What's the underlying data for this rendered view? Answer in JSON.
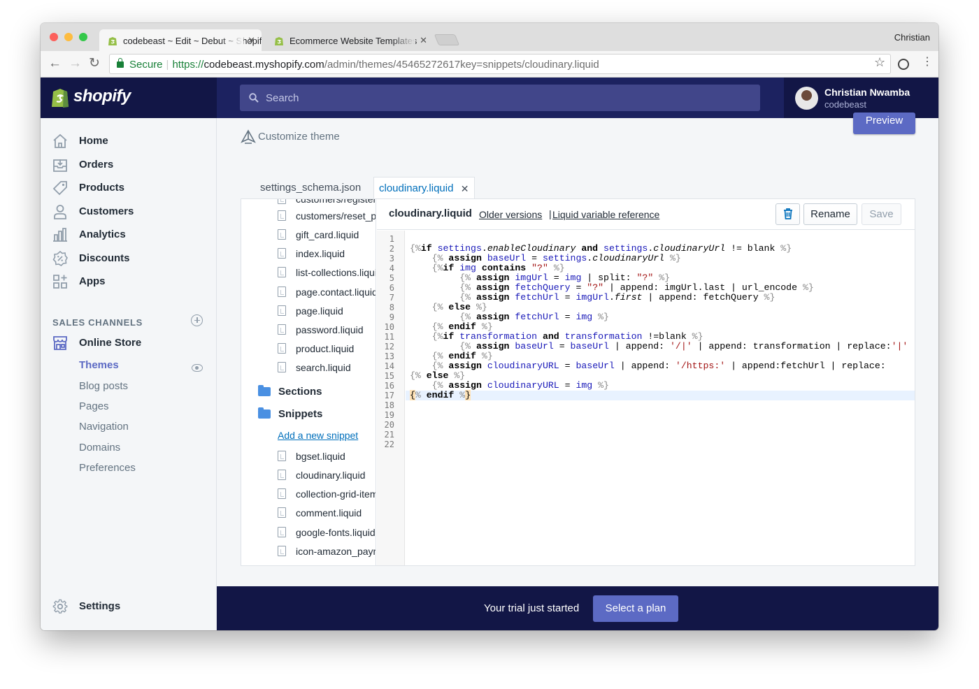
{
  "browser": {
    "tabs": [
      {
        "title": "codebeast ~ Edit ~ Debut ~ Shopify"
      },
      {
        "title": "Ecommerce Website Templates"
      }
    ],
    "user": "Christian",
    "address": {
      "secure_label": "Secure",
      "protocol": "https://",
      "host": "codebeast.myshopify.com",
      "path": "/admin/themes/45465272617key=snippets/cloudinary.liquid"
    }
  },
  "topbar": {
    "logo_text": "shopify",
    "search_placeholder": "Search",
    "account_name": "Christian Nwamba",
    "account_shop": "codebeast"
  },
  "sidebar": {
    "items": [
      {
        "label": "Home",
        "icon": "home-icon"
      },
      {
        "label": "Orders",
        "icon": "orders-icon"
      },
      {
        "label": "Products",
        "icon": "tag-icon"
      },
      {
        "label": "Customers",
        "icon": "person-icon"
      },
      {
        "label": "Analytics",
        "icon": "bar-chart-icon"
      },
      {
        "label": "Discounts",
        "icon": "discount-icon"
      },
      {
        "label": "Apps",
        "icon": "apps-icon"
      }
    ],
    "channels_heading": "SALES CHANNELS",
    "online_store": "Online Store",
    "sub_items": [
      "Themes",
      "Blog posts",
      "Pages",
      "Navigation",
      "Domains",
      "Preferences"
    ],
    "settings": "Settings"
  },
  "main": {
    "customize": "Customize theme",
    "preview": "Preview",
    "file_tabs": [
      "settings_schema.json",
      "cloudinary.liquid"
    ],
    "tree": {
      "templates_top": [
        "customers/register.liquid",
        "customers/reset_password.liquid",
        "gift_card.liquid",
        "index.liquid",
        "list-collections.liquid",
        "page.contact.liquid",
        "page.liquid",
        "password.liquid",
        "product.liquid",
        "search.liquid"
      ],
      "sections_folder": "Sections",
      "snippets_folder": "Snippets",
      "add_snippet": "Add a new snippet",
      "snippets": [
        "bgset.liquid",
        "cloudinary.liquid",
        "collection-grid-item.liquid",
        "comment.liquid",
        "google-fonts.liquid",
        "icon-amazon_payments.liquid"
      ]
    },
    "editor": {
      "filename": "cloudinary.liquid",
      "older_versions": "Older versions",
      "pipe": "|",
      "liquid_ref": "Liquid variable reference",
      "rename": "Rename",
      "save": "Save",
      "line_numbers": [
        "1",
        "2",
        "3",
        "4",
        "5",
        "6",
        "7",
        "8",
        "9",
        "10",
        "11",
        "12",
        "13",
        "14",
        "15",
        "16",
        "17",
        "18",
        "19",
        "20",
        "21",
        "22"
      ]
    }
  },
  "footer": {
    "trial_text": "Your trial just started",
    "select_plan": "Select a plan"
  },
  "colors": {
    "top_nav": "#1c2260",
    "top_nav_dark": "#121646",
    "accent": "#5c6ac4",
    "link": "#006fbb"
  }
}
